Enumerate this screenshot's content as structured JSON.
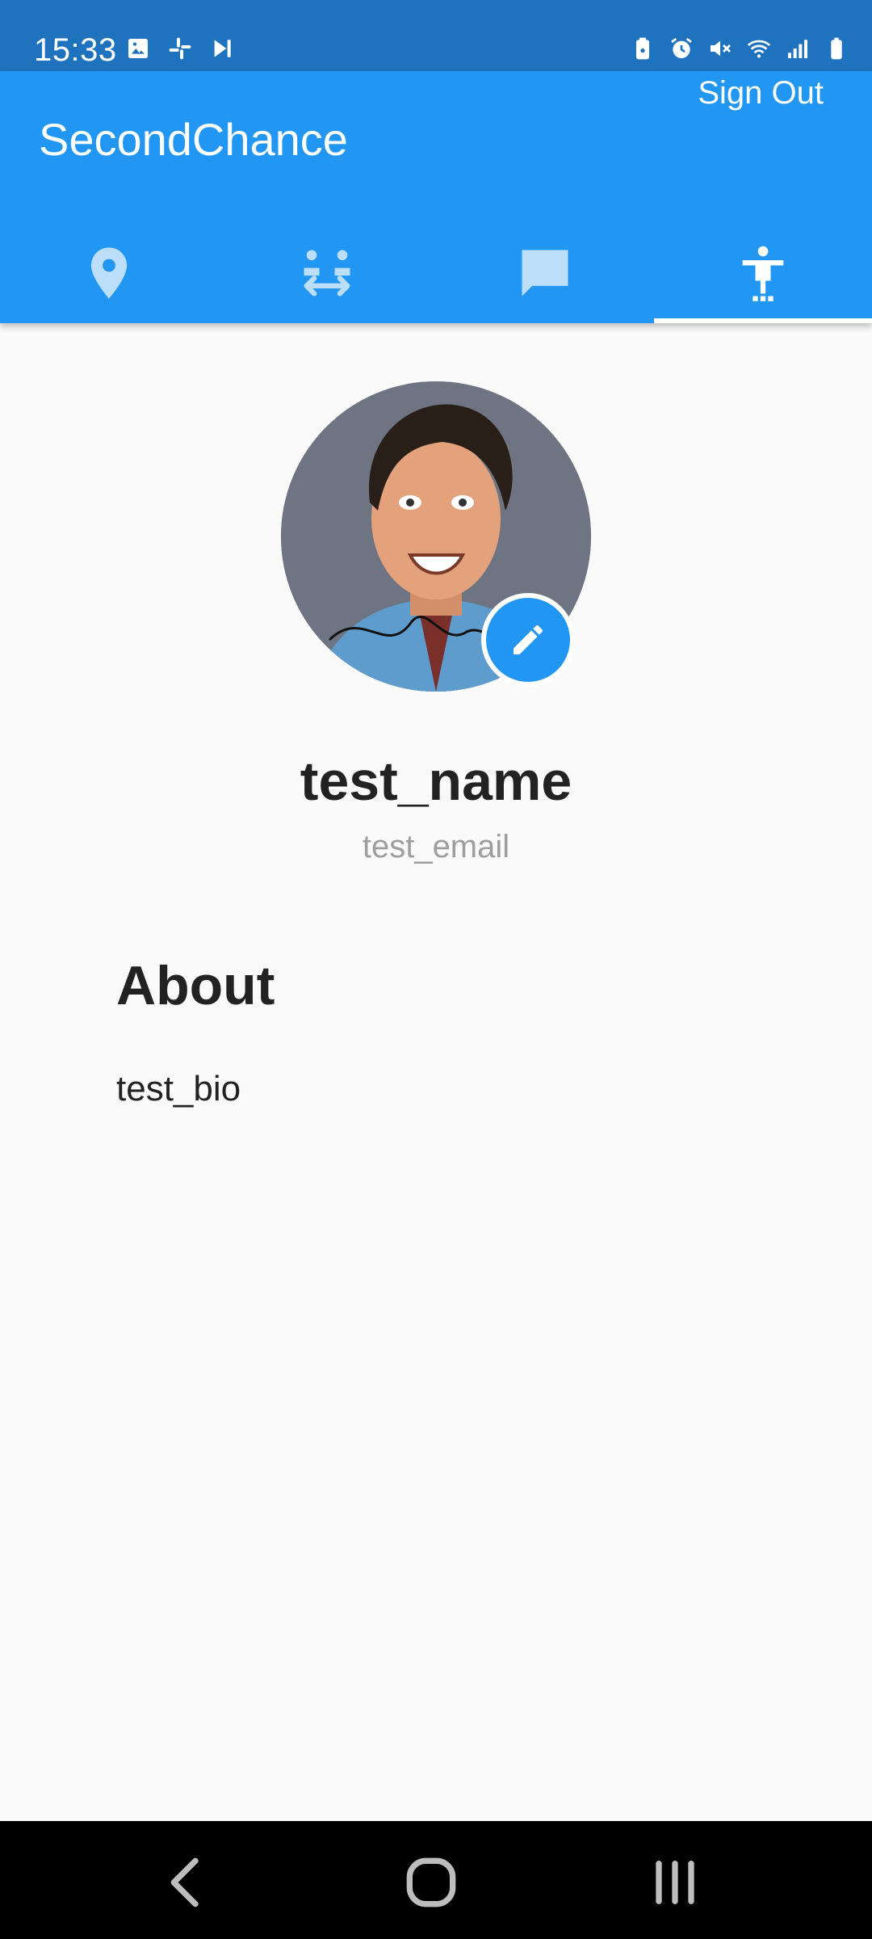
{
  "status_bar": {
    "time": "15:33",
    "left_icons": [
      "image-icon",
      "slack-icon",
      "media-skip-icon"
    ],
    "right_icons": [
      "battery-saver-icon",
      "alarm-icon",
      "mute-icon",
      "wifi-icon",
      "signal-icon",
      "battery-icon"
    ]
  },
  "app_bar": {
    "title": "SecondChance",
    "sign_out_label": "Sign Out",
    "background_color": "#2196f3"
  },
  "tabs": [
    {
      "icon": "location-pin-icon",
      "active": false
    },
    {
      "icon": "people-exchange-icon",
      "active": false
    },
    {
      "icon": "chat-bubble-icon",
      "active": false
    },
    {
      "icon": "person-accessibility-icon",
      "active": true
    }
  ],
  "profile": {
    "name": "test_name",
    "email": "test_email",
    "about_heading": "About",
    "bio": "test_bio",
    "edit_icon": "pencil-icon"
  },
  "nav_bar": {
    "buttons": [
      "back-icon",
      "home-icon",
      "recents-icon"
    ]
  }
}
